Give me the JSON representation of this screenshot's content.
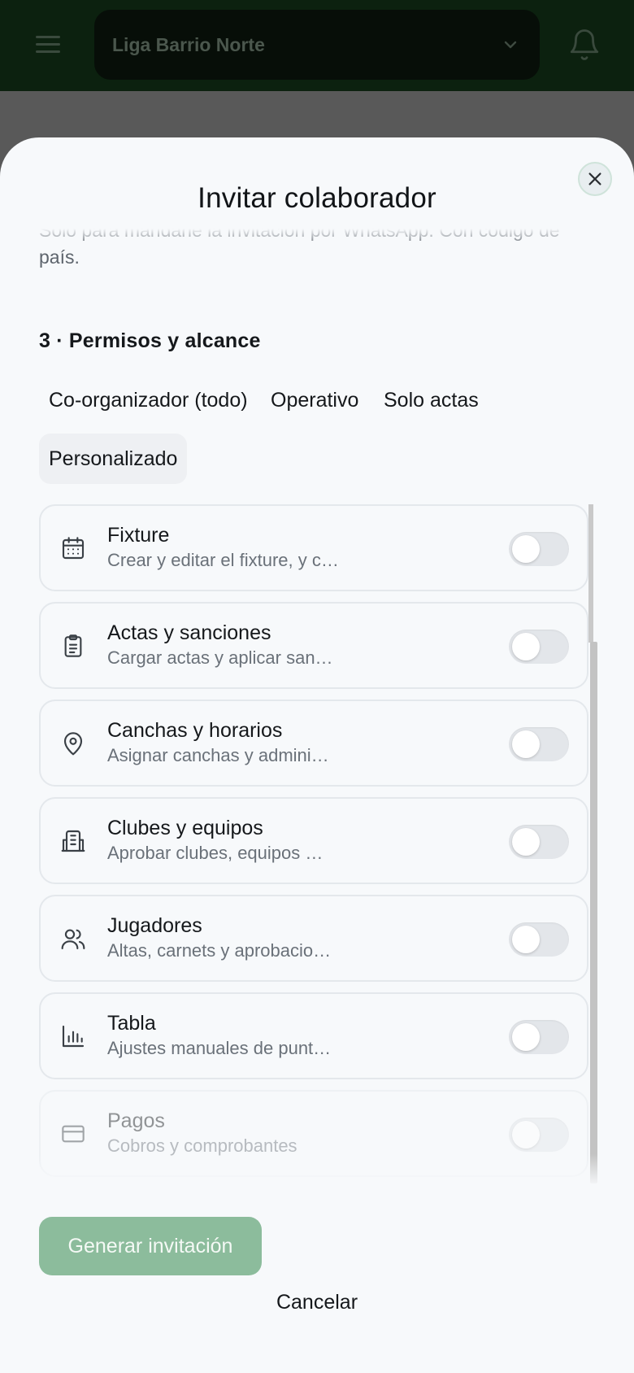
{
  "appbar": {
    "league_name": "Liga Barrio Norte",
    "menu_icon": "hamburger-menu-icon",
    "dropdown_icon": "chevron-down-icon",
    "notification_icon": "bell-icon"
  },
  "modal": {
    "title": "Invitar colaborador",
    "close_icon": "close-icon",
    "phone_helper": "Solo para mandarle la invitación por WhatsApp. Con código de país.",
    "section_title": "3 · Permisos y alcance",
    "presets": [
      {
        "label": "Co-organizador (todo)",
        "selected": false
      },
      {
        "label": "Operativo",
        "selected": false
      },
      {
        "label": "Solo actas",
        "selected": false
      },
      {
        "label": "Personalizado",
        "selected": true
      }
    ],
    "permissions": [
      {
        "name": "Fixture",
        "description": "Crear y editar el fixture, y c…",
        "icon": "calendar-icon",
        "enabled": false,
        "disabled": false
      },
      {
        "name": "Actas y sanciones",
        "description": "Cargar actas y aplicar san…",
        "icon": "clipboard-list-icon",
        "enabled": false,
        "disabled": false
      },
      {
        "name": "Canchas y horarios",
        "description": "Asignar canchas y admini…",
        "icon": "map-pin-icon",
        "enabled": false,
        "disabled": false
      },
      {
        "name": "Clubes y equipos",
        "description": "Aprobar clubes, equipos …",
        "icon": "building-icon",
        "enabled": false,
        "disabled": false
      },
      {
        "name": "Jugadores",
        "description": "Altas, carnets y aprobacio…",
        "icon": "users-icon",
        "enabled": false,
        "disabled": false
      },
      {
        "name": "Tabla",
        "description": "Ajustes manuales de punt…",
        "icon": "bar-chart-icon",
        "enabled": false,
        "disabled": false
      },
      {
        "name": "Pagos",
        "description": "Cobros y comprobantes",
        "icon": "credit-card-icon",
        "enabled": false,
        "disabled": true
      }
    ],
    "generate_button": "Generar invitación",
    "cancel_button": "Cancelar",
    "colors": {
      "accent": "#8cbc9c",
      "appbar": "#0c210f",
      "sheet_bg": "#f7f9fb",
      "overlay": "#595959"
    }
  }
}
